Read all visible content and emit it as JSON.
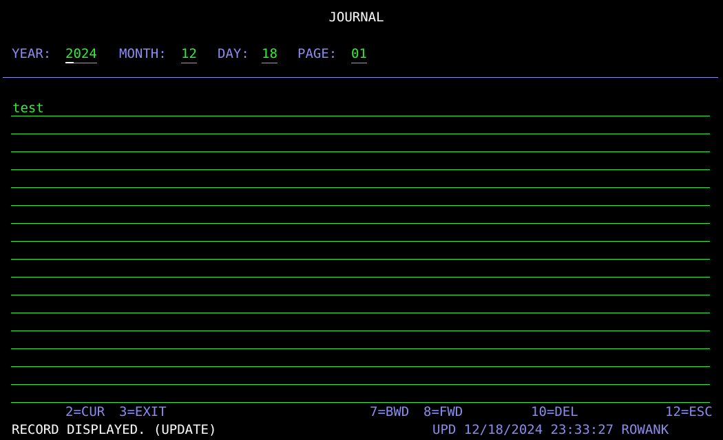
{
  "screen": {
    "title": "JOURNAL"
  },
  "header": {
    "year_label": "YEAR:",
    "year_value": "2024",
    "month_label": "MONTH:",
    "month_value": "12",
    "day_label": "DAY:",
    "day_value": "18",
    "page_label": "PAGE:",
    "page_value": "01"
  },
  "journal": {
    "lines": [
      "test",
      "",
      "",
      "",
      "",
      "",
      "",
      "",
      "",
      "",
      "",
      "",
      "",
      "",
      "",
      "",
      ""
    ]
  },
  "function_keys": {
    "cur": "2=CUR",
    "exit": "3=EXIT",
    "bwd": "7=BWD",
    "fwd": "8=FWD",
    "del": "10=DEL",
    "esc": "12=ESC"
  },
  "status": {
    "message": "RECORD DISPLAYED. (UPDATE)",
    "update_info": "UPD 12/18/2024 23:33:27 ROWANK"
  },
  "colors": {
    "background": "#000000",
    "label_blue": "#8c8cf0",
    "field_green": "#31ef31",
    "text_white": "#ffffff"
  }
}
